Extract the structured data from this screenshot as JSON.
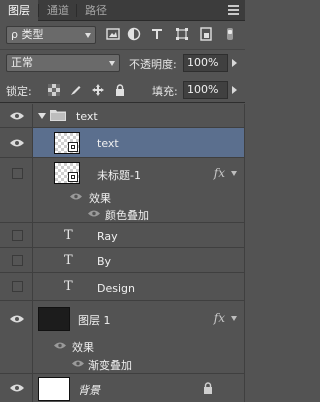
{
  "tabs": [
    {
      "label": "图层",
      "active": true
    },
    {
      "label": "通道",
      "active": false
    },
    {
      "label": "路径",
      "active": false
    }
  ],
  "filter": {
    "kind_label": "ρ 类型",
    "icons": [
      "image-filter-icon",
      "adjustment-filter-icon",
      "type-filter-icon",
      "shape-filter-icon",
      "smart-object-filter-icon"
    ]
  },
  "blend": {
    "mode": "正常",
    "opacity_label": "不透明度:",
    "opacity_value": "100%"
  },
  "lock": {
    "label": "锁定:",
    "fill_label": "填充:",
    "fill_value": "100%"
  },
  "layers": {
    "group_name": "text",
    "text_layer": "text",
    "untitled_layer": "未标题-1",
    "untitled_effects_label": "效果",
    "untitled_effect_1": "颜色叠加",
    "ray": "Ray",
    "by": "By",
    "design": "Design",
    "layer1": "图层 1",
    "layer1_effects_label": "效果",
    "layer1_effect_1": "渐变叠加",
    "background": "背景",
    "fx_label": "fx",
    "t_glyph": "T"
  },
  "colors": {
    "panel_bg": "#535353",
    "selected_row": "#5b6f8e",
    "tab_bar": "#3c3c3c"
  }
}
